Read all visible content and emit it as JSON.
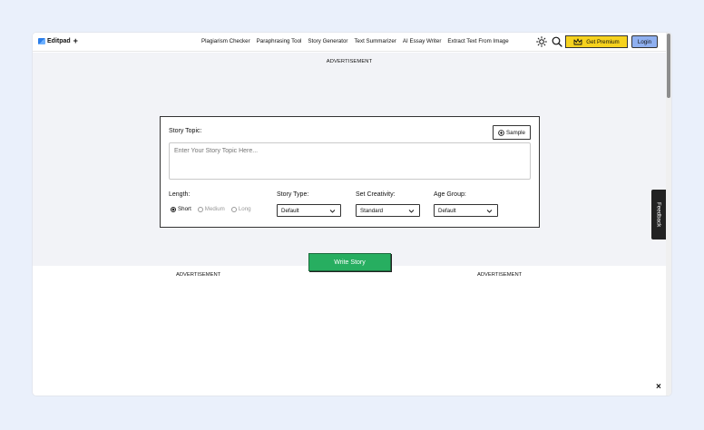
{
  "header": {
    "logo_text": "Editpad",
    "logo_plus": "+",
    "nav_links": [
      "Plagiarism Checker",
      "Paraphrasing Tool",
      "Story Generator",
      "Text Summarizer",
      "AI Essay Writer",
      "Extract Text From Image"
    ],
    "premium_label": "Get Premium",
    "login_label": "Login"
  },
  "ads": {
    "top": "ADVERTISEMENT",
    "left": "ADVERTISEMENT",
    "right": "ADVERTISEMENT"
  },
  "form": {
    "topic_label": "Story Topic:",
    "sample_label": "Sample",
    "topic_placeholder": "Enter Your Story Topic Here...",
    "length_label": "Length:",
    "length_options": [
      {
        "label": "Short",
        "selected": true
      },
      {
        "label": "Medium",
        "selected": false
      },
      {
        "label": "Long",
        "selected": false
      }
    ],
    "story_type_label": "Story Type:",
    "story_type_value": "Default",
    "creativity_label": "Set Creativity:",
    "creativity_value": "Standard",
    "age_group_label": "Age Group:",
    "age_group_value": "Default",
    "submit_label": "Write Story"
  },
  "feedback_label": "Feedback",
  "close_symbol": "×",
  "colors": {
    "premium": "#f6d21e",
    "login": "#8fb0f0",
    "submit": "#27ae60",
    "page_bg": "#eaf0fb"
  }
}
